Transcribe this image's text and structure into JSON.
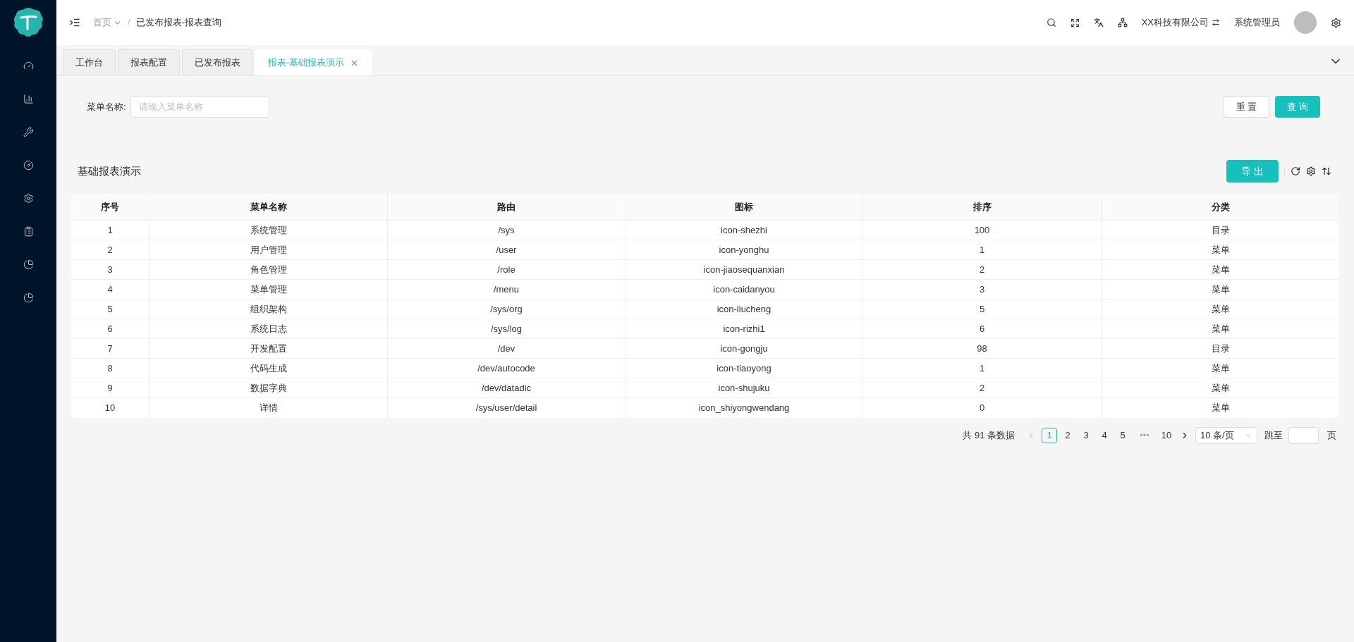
{
  "header": {
    "breadcrumb": [
      "首页",
      "/",
      "已发布报表-报表查询"
    ],
    "company": "XX科技有限公司",
    "user": "系统管理员"
  },
  "tabs": [
    {
      "label": "工作台",
      "selected": false,
      "closable": false
    },
    {
      "label": "报表配置",
      "selected": false,
      "closable": false
    },
    {
      "label": "已发布报表",
      "selected": false,
      "closable": false
    },
    {
      "label": "报表-基础报表演示",
      "selected": true,
      "closable": true
    }
  ],
  "search": {
    "label": "菜单名称:",
    "placeholder": "请输入菜单名称",
    "buttons": [
      "重 置",
      "查 询"
    ]
  },
  "report": {
    "title": "基础报表演示",
    "export": "导 出"
  },
  "table": {
    "columns": [
      "序号",
      "菜单名称",
      "路由",
      "图标",
      "排序",
      "分类"
    ],
    "rows": [
      [
        "1",
        "系统管理",
        "/sys",
        "icon-shezhi",
        "100",
        "目录"
      ],
      [
        "2",
        "用户管理",
        "/user",
        "icon-yonghu",
        "1",
        "菜单"
      ],
      [
        "3",
        "角色管理",
        "/role",
        "icon-jiaosequanxian",
        "2",
        "菜单"
      ],
      [
        "4",
        "菜单管理",
        "/menu",
        "icon-caidanyou",
        "3",
        "菜单"
      ],
      [
        "5",
        "组织架构",
        "/sys/org",
        "icon-liucheng",
        "5",
        "菜单"
      ],
      [
        "6",
        "系统日志",
        "/sys/log",
        "icon-rizhi1",
        "6",
        "菜单"
      ],
      [
        "7",
        "开发配置",
        "/dev",
        "icon-gongju",
        "98",
        "目录"
      ],
      [
        "8",
        "代码生成",
        "/dev/autocode",
        "icon-tiaoyong",
        "1",
        "菜单"
      ],
      [
        "9",
        "数据字典",
        "/dev/datadic",
        "icon-shujuku",
        "2",
        "菜单"
      ],
      [
        "10",
        "详情",
        "/sys/user/detail",
        "icon_shiyongwendang",
        "0",
        "菜单"
      ]
    ]
  },
  "pagination": {
    "total": "共 91 条数据",
    "pages": [
      {
        "label": "1",
        "selected": true
      },
      {
        "label": "2",
        "selected": false
      },
      {
        "label": "3",
        "selected": false
      },
      {
        "label": "4",
        "selected": false
      },
      {
        "label": "5",
        "selected": false
      },
      {
        "label": "•••",
        "selected": false
      },
      {
        "label": "10",
        "selected": false
      }
    ],
    "page_size": "10 条/页",
    "jump_label": "跳至",
    "jump_suffix": "页"
  }
}
